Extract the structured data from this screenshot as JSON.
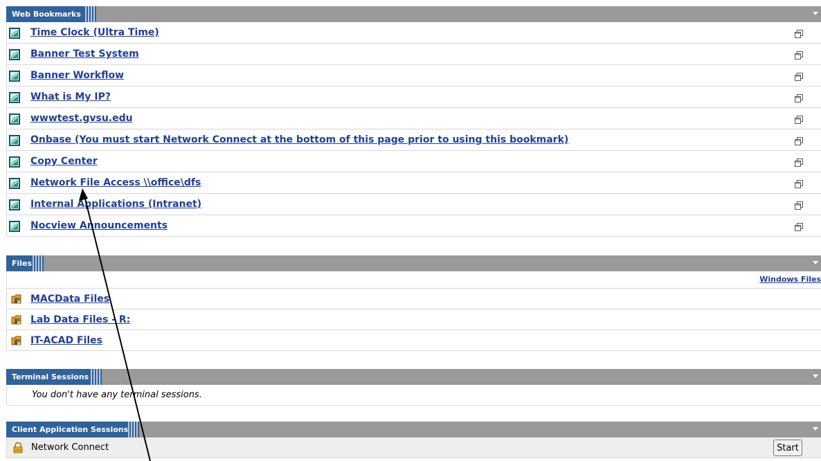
{
  "web_bookmarks": {
    "title": "Web Bookmarks",
    "items": [
      {
        "label": "Time Clock (Ultra Time)"
      },
      {
        "label": "Banner Test System"
      },
      {
        "label": "Banner Workflow"
      },
      {
        "label": "What is My IP?"
      },
      {
        "label": "wwwtest.gvsu.edu"
      },
      {
        "label": "Onbase (You must start Network Connect at the bottom of this page prior to using this bookmark)"
      },
      {
        "label": "Copy Center"
      },
      {
        "label": "Network File Access \\\\office\\dfs"
      },
      {
        "label": "Internal Applications (Intranet)"
      },
      {
        "label": "Nocview Announcements"
      }
    ]
  },
  "files": {
    "title": "Files",
    "windows_files_link": "Windows Files",
    "items": [
      {
        "label": "MACData Files"
      },
      {
        "label": "Lab Data Files - R:"
      },
      {
        "label": "IT-ACAD Files"
      }
    ]
  },
  "terminal_sessions": {
    "title": "Terminal Sessions",
    "empty_message": "You don't have any terminal sessions."
  },
  "client_application_sessions": {
    "title": "Client Application Sessions",
    "items": [
      {
        "label": "Network Connect",
        "button_label": "Start"
      }
    ]
  },
  "colors": {
    "header_blue": "#30629b",
    "header_gray": "#9a9a9a",
    "link_blue": "#1f3f9a"
  },
  "icons": {
    "bookmark": "web-bookmark-icon",
    "popout": "open-new-window-icon",
    "folder": "windows-folder-icon",
    "lock": "lock-icon",
    "collapse": "collapse-triangle-icon"
  }
}
